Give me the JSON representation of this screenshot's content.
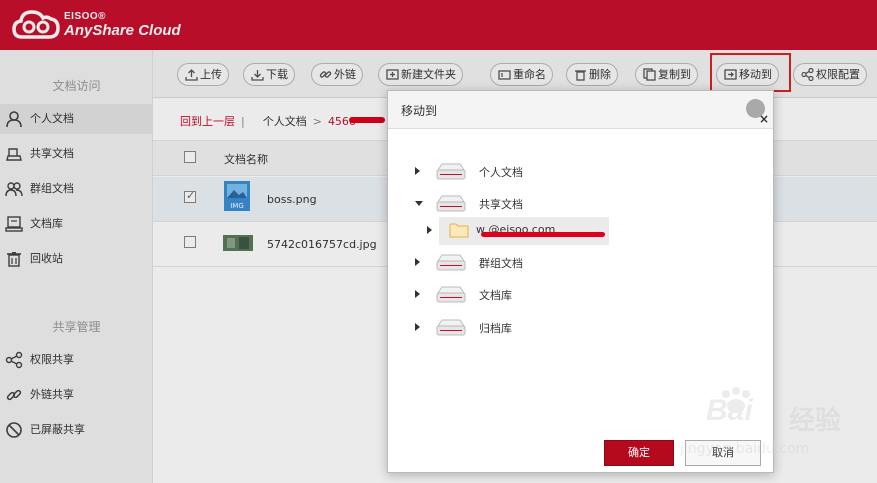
{
  "header": {
    "brand_small": "EISOO®",
    "brand_big": "AnyShare Cloud"
  },
  "sidebar": {
    "section1": "文档访问",
    "items1": [
      {
        "label": "个人文档",
        "icon": "user-icon"
      },
      {
        "label": "共享文档",
        "icon": "shared-doc-icon"
      },
      {
        "label": "群组文档",
        "icon": "group-icon"
      },
      {
        "label": "文档库",
        "icon": "library-icon"
      },
      {
        "label": "回收站",
        "icon": "trash-icon"
      }
    ],
    "section2": "共享管理",
    "items2": [
      {
        "label": "权限共享",
        "icon": "share-icon"
      },
      {
        "label": "外链共享",
        "icon": "link-icon"
      },
      {
        "label": "已屏蔽共享",
        "icon": "blocked-icon"
      }
    ]
  },
  "toolbar": {
    "upload": "上传",
    "download": "下载",
    "outlink": "外链",
    "new_folder": "新建文件夹",
    "rename": "重命名",
    "delete": "删除",
    "copy_to": "复制到",
    "move_to": "移动到",
    "permissions": "权限配置"
  },
  "breadcrumb": {
    "back": "回到上一层",
    "sep": "|",
    "personal": "个人文档",
    "arrow": ">",
    "current": "4566"
  },
  "file_list": {
    "column_name": "文档名称",
    "files": [
      {
        "name": "boss.png",
        "checked": true
      },
      {
        "name": "5742c016757cd.jpg",
        "checked": false
      }
    ]
  },
  "dialog": {
    "title": "移动到",
    "close": "×",
    "tree": [
      {
        "label": "个人文档",
        "expanded": false
      },
      {
        "label": "共享文档",
        "expanded": true
      },
      {
        "label": "w       @eisoo.com",
        "folder": true
      },
      {
        "label": "群组文档",
        "expanded": false
      },
      {
        "label": "文档库",
        "expanded": false
      },
      {
        "label": "归档库",
        "expanded": false
      }
    ],
    "ok": "确定",
    "cancel": "取消"
  },
  "watermark": {
    "text": "Bai",
    "cn": "经验",
    "sub": "jingyan.baidu.com"
  },
  "colors": {
    "brand_red": "#c8102e",
    "ok_red": "#b50a1d",
    "highlight_red": "#e02020"
  }
}
